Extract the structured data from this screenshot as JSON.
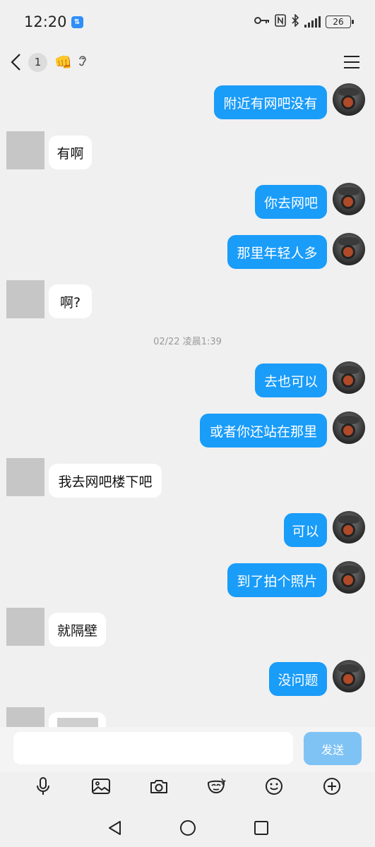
{
  "status_bar": {
    "time": "12:20",
    "data_badge": "⇅",
    "battery": "26"
  },
  "header": {
    "unread_count": "1",
    "fist_emoji": "👊"
  },
  "messages": {
    "m1": "附近有网吧没有",
    "m2": "有啊",
    "m3": "你去网吧",
    "m4": "那里年轻人多",
    "m5": "啊?",
    "timestamp": "02/22 凌晨1:39",
    "m6": "去也可以",
    "m7": "或者你还站在那里",
    "m8": "我去网吧楼下吧",
    "m9": "可以",
    "m10": "到了拍个照片",
    "m11": "就隔壁",
    "m12": "没问题"
  },
  "input": {
    "send_label": "发送",
    "placeholder": ""
  },
  "colors": {
    "bubble_right": "#1a9cf9",
    "send_button": "#7fc3f5"
  }
}
